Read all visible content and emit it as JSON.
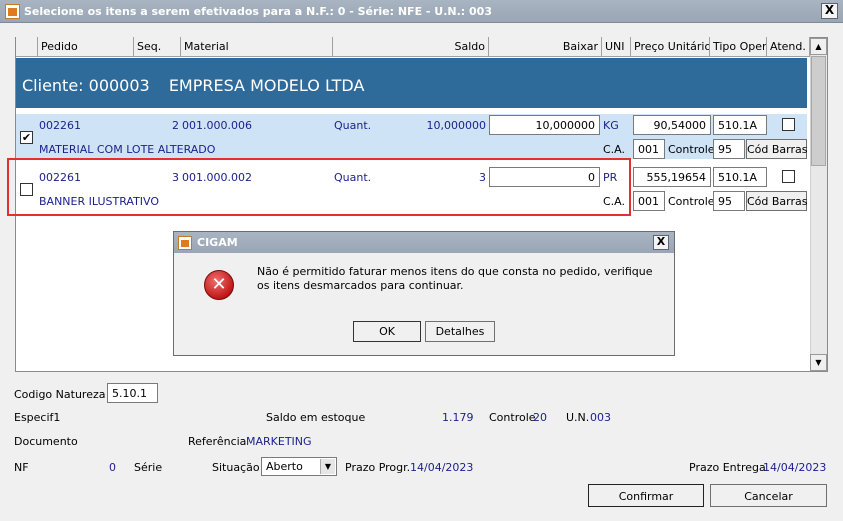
{
  "window": {
    "title": "Selecione os itens a serem efetivados para a N.F.: 0 - Série: NFE - U.N.: 003",
    "close_label": "X"
  },
  "grid": {
    "headers": {
      "pedido": "Pedido",
      "seq": "Seq.",
      "material": "Material",
      "saldo": "Saldo",
      "baixar": "Baixar",
      "uni": "UNI",
      "preco": "Preço Unitário",
      "tipo_oper": "Tipo Oper.",
      "atend": "Atend."
    },
    "client_label": "Cliente: 000003",
    "client_name": "EMPRESA MODELO LTDA",
    "rows": [
      {
        "checked": true,
        "check_mark": "✔",
        "pedido": "002261",
        "seq": "2",
        "material": "001.000.006",
        "quant_label": "Quant.",
        "saldo": "10,000000",
        "baixar": "10,000000",
        "uni": "KG",
        "preco": "90,54000",
        "tipo_oper": "510.1A",
        "desc": "MATERIAL COM LOTE ALTERADO",
        "ca_label": "C.A.",
        "ca_value": "001",
        "controle_label": "Controle",
        "controle_value": "95",
        "cod_barras_label": "Cód Barras"
      },
      {
        "checked": false,
        "check_mark": "",
        "pedido": "002261",
        "seq": "3",
        "material": "001.000.002",
        "quant_label": "Quant.",
        "saldo": "3",
        "baixar": "0",
        "uni": "PR",
        "preco": "555,19654",
        "tipo_oper": "510.1A",
        "desc": "BANNER ILUSTRATIVO",
        "ca_label": "C.A.",
        "ca_value": "001",
        "controle_label": "Controle",
        "controle_value": "95",
        "cod_barras_label": "Cód Barras"
      }
    ]
  },
  "dialog": {
    "title": "CIGAM",
    "close_label": "X",
    "icon": "error-icon",
    "icon_glyph": "✕",
    "message": "Não é permitido faturar menos itens do que consta no pedido, verifique os itens desmarcados para continuar.",
    "ok_label": "OK",
    "details_label": "Detalhes"
  },
  "form": {
    "codigo_natureza_label": "Codigo Natureza",
    "codigo_natureza_value": "5.10.1",
    "especif_label": "Especif1",
    "saldo_estoque_label": "Saldo em estoque",
    "saldo_estoque_value": "1.179",
    "controle_label": "Controle",
    "controle_value": "20",
    "un_label": "U.N.",
    "un_value": "003",
    "documento_label": "Documento",
    "referencia_label": "Referência",
    "referencia_value": "MARKETING",
    "nf_label": "NF",
    "nf_value": "0",
    "serie_label": "Série",
    "situacao_label": "Situação",
    "situacao_value": "Aberto",
    "prazo_progr_label": "Prazo Progr.",
    "prazo_progr_value": "14/04/2023",
    "prazo_entrega_label": "Prazo Entrega",
    "prazo_entrega_value": "14/04/2023",
    "confirmar_label": "Confirmar",
    "cancelar_label": "Cancelar"
  },
  "colors": {
    "client_band": "#2f6b9a",
    "selected_row": "#cfe3f7",
    "highlight_frame": "#e03030",
    "value_text": "#1b1f8a"
  }
}
